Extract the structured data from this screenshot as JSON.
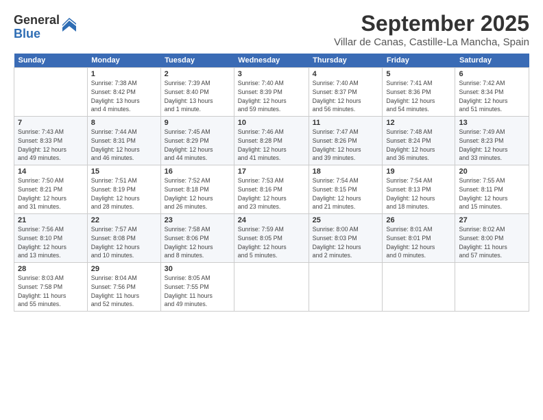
{
  "logo": {
    "general": "General",
    "blue": "Blue"
  },
  "header": {
    "title": "September 2025",
    "location": "Villar de Canas, Castille-La Mancha, Spain"
  },
  "weekdays": [
    "Sunday",
    "Monday",
    "Tuesday",
    "Wednesday",
    "Thursday",
    "Friday",
    "Saturday"
  ],
  "weeks": [
    [
      {
        "day": "",
        "info": ""
      },
      {
        "day": "1",
        "info": "Sunrise: 7:38 AM\nSunset: 8:42 PM\nDaylight: 13 hours\nand 4 minutes."
      },
      {
        "day": "2",
        "info": "Sunrise: 7:39 AM\nSunset: 8:40 PM\nDaylight: 13 hours\nand 1 minute."
      },
      {
        "day": "3",
        "info": "Sunrise: 7:40 AM\nSunset: 8:39 PM\nDaylight: 12 hours\nand 59 minutes."
      },
      {
        "day": "4",
        "info": "Sunrise: 7:40 AM\nSunset: 8:37 PM\nDaylight: 12 hours\nand 56 minutes."
      },
      {
        "day": "5",
        "info": "Sunrise: 7:41 AM\nSunset: 8:36 PM\nDaylight: 12 hours\nand 54 minutes."
      },
      {
        "day": "6",
        "info": "Sunrise: 7:42 AM\nSunset: 8:34 PM\nDaylight: 12 hours\nand 51 minutes."
      }
    ],
    [
      {
        "day": "7",
        "info": "Sunrise: 7:43 AM\nSunset: 8:33 PM\nDaylight: 12 hours\nand 49 minutes."
      },
      {
        "day": "8",
        "info": "Sunrise: 7:44 AM\nSunset: 8:31 PM\nDaylight: 12 hours\nand 46 minutes."
      },
      {
        "day": "9",
        "info": "Sunrise: 7:45 AM\nSunset: 8:29 PM\nDaylight: 12 hours\nand 44 minutes."
      },
      {
        "day": "10",
        "info": "Sunrise: 7:46 AM\nSunset: 8:28 PM\nDaylight: 12 hours\nand 41 minutes."
      },
      {
        "day": "11",
        "info": "Sunrise: 7:47 AM\nSunset: 8:26 PM\nDaylight: 12 hours\nand 39 minutes."
      },
      {
        "day": "12",
        "info": "Sunrise: 7:48 AM\nSunset: 8:24 PM\nDaylight: 12 hours\nand 36 minutes."
      },
      {
        "day": "13",
        "info": "Sunrise: 7:49 AM\nSunset: 8:23 PM\nDaylight: 12 hours\nand 33 minutes."
      }
    ],
    [
      {
        "day": "14",
        "info": "Sunrise: 7:50 AM\nSunset: 8:21 PM\nDaylight: 12 hours\nand 31 minutes."
      },
      {
        "day": "15",
        "info": "Sunrise: 7:51 AM\nSunset: 8:19 PM\nDaylight: 12 hours\nand 28 minutes."
      },
      {
        "day": "16",
        "info": "Sunrise: 7:52 AM\nSunset: 8:18 PM\nDaylight: 12 hours\nand 26 minutes."
      },
      {
        "day": "17",
        "info": "Sunrise: 7:53 AM\nSunset: 8:16 PM\nDaylight: 12 hours\nand 23 minutes."
      },
      {
        "day": "18",
        "info": "Sunrise: 7:54 AM\nSunset: 8:15 PM\nDaylight: 12 hours\nand 21 minutes."
      },
      {
        "day": "19",
        "info": "Sunrise: 7:54 AM\nSunset: 8:13 PM\nDaylight: 12 hours\nand 18 minutes."
      },
      {
        "day": "20",
        "info": "Sunrise: 7:55 AM\nSunset: 8:11 PM\nDaylight: 12 hours\nand 15 minutes."
      }
    ],
    [
      {
        "day": "21",
        "info": "Sunrise: 7:56 AM\nSunset: 8:10 PM\nDaylight: 12 hours\nand 13 minutes."
      },
      {
        "day": "22",
        "info": "Sunrise: 7:57 AM\nSunset: 8:08 PM\nDaylight: 12 hours\nand 10 minutes."
      },
      {
        "day": "23",
        "info": "Sunrise: 7:58 AM\nSunset: 8:06 PM\nDaylight: 12 hours\nand 8 minutes."
      },
      {
        "day": "24",
        "info": "Sunrise: 7:59 AM\nSunset: 8:05 PM\nDaylight: 12 hours\nand 5 minutes."
      },
      {
        "day": "25",
        "info": "Sunrise: 8:00 AM\nSunset: 8:03 PM\nDaylight: 12 hours\nand 2 minutes."
      },
      {
        "day": "26",
        "info": "Sunrise: 8:01 AM\nSunset: 8:01 PM\nDaylight: 12 hours\nand 0 minutes."
      },
      {
        "day": "27",
        "info": "Sunrise: 8:02 AM\nSunset: 8:00 PM\nDaylight: 11 hours\nand 57 minutes."
      }
    ],
    [
      {
        "day": "28",
        "info": "Sunrise: 8:03 AM\nSunset: 7:58 PM\nDaylight: 11 hours\nand 55 minutes."
      },
      {
        "day": "29",
        "info": "Sunrise: 8:04 AM\nSunset: 7:56 PM\nDaylight: 11 hours\nand 52 minutes."
      },
      {
        "day": "30",
        "info": "Sunrise: 8:05 AM\nSunset: 7:55 PM\nDaylight: 11 hours\nand 49 minutes."
      },
      {
        "day": "",
        "info": ""
      },
      {
        "day": "",
        "info": ""
      },
      {
        "day": "",
        "info": ""
      },
      {
        "day": "",
        "info": ""
      }
    ]
  ]
}
